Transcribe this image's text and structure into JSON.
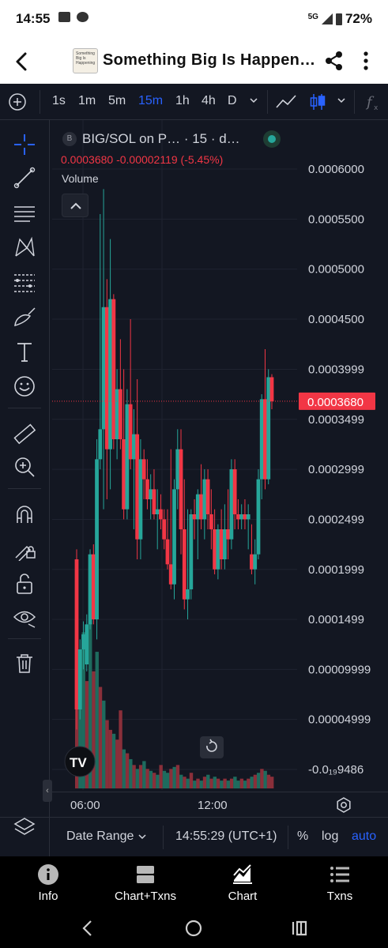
{
  "status_bar": {
    "time": "14:55",
    "network": "5G",
    "battery": "72%"
  },
  "app_bar": {
    "title": "Something Big Is Happeni…",
    "thumbnail_text": "Something Big Is Happening"
  },
  "toolbar": {
    "intervals": [
      "1s",
      "1m",
      "5m",
      "15m",
      "1h",
      "4h",
      "D"
    ],
    "active_interval": "15m"
  },
  "legend": {
    "chip": "B",
    "symbol": "BIG/SOL on P…",
    "interval_text": "· 15 · d…",
    "price_line": "0.0003680  -0.00002119 (-5.45%)",
    "volume_label": "Volume"
  },
  "colors": {
    "up": "#26a69a",
    "down": "#f23645",
    "vol_up": "#1e6b5e",
    "vol_down": "#8a2f3a",
    "background": "#131722",
    "accent": "#2962ff"
  },
  "chart_data": {
    "type": "candlestick",
    "pair": "BIG/SOL",
    "interval": "15",
    "y_ticks": [
      "0.0006000",
      "0.0005500",
      "0.0005000",
      "0.0004500",
      "0.0003999",
      "0.0003499",
      "0.0002999",
      "0.0002499",
      "0.0001999",
      "0.0001499",
      "0.00009999",
      "0.00004999",
      "-0.0₁₉9486"
    ],
    "y_tick_values": [
      0.0006,
      0.00055,
      0.0005,
      0.00045,
      0.0003999,
      0.0003499,
      0.0002999,
      0.0002499,
      0.0001999,
      0.0001499,
      9.999e-05,
      4.999e-05,
      0
    ],
    "ylim": [
      0,
      0.0006
    ],
    "x_ticks": [
      "06:00",
      "12:00"
    ],
    "last_price": "0.0003680",
    "last_price_value": 0.000368,
    "grid": true,
    "candles": [
      {
        "o": 0.00021,
        "h": 0.00022,
        "l": 4e-05,
        "c": 6e-05
      },
      {
        "o": 6e-05,
        "h": 0.00013,
        "l": 5e-05,
        "c": 0.00012
      },
      {
        "o": 0.00012,
        "h": 0.000148,
        "l": 0.0001,
        "c": 0.000135
      },
      {
        "o": 0.000105,
        "h": 0.000155,
        "l": 9.8e-05,
        "c": 0.000145
      },
      {
        "o": 0.000145,
        "h": 0.00022,
        "l": 0.00014,
        "c": 0.000215
      },
      {
        "o": 0.000215,
        "h": 0.000225,
        "l": 0.000145,
        "c": 0.00015
      },
      {
        "o": 0.00015,
        "h": 0.00033,
        "l": 0.00013,
        "c": 0.00031
      },
      {
        "o": 0.00031,
        "h": 0.000555,
        "l": 0.0003,
        "c": 0.00034
      },
      {
        "o": 0.00034,
        "h": 0.00058,
        "l": 0.00026,
        "c": 0.000462
      },
      {
        "o": 0.000462,
        "h": 0.00049,
        "l": 0.00027,
        "c": 0.00032
      },
      {
        "o": 0.00032,
        "h": 0.00053,
        "l": 0.00028,
        "c": 0.00047
      },
      {
        "o": 0.00047,
        "h": 0.000475,
        "l": 0.00032,
        "c": 0.00033
      },
      {
        "o": 0.00033,
        "h": 0.0004,
        "l": 0.00031,
        "c": 0.00038
      },
      {
        "o": 0.00038,
        "h": 0.00043,
        "l": 0.00032,
        "c": 0.00033
      },
      {
        "o": 0.00033,
        "h": 0.0004,
        "l": 0.00025,
        "c": 0.00026
      },
      {
        "o": 0.00026,
        "h": 0.00038,
        "l": 0.00025,
        "c": 0.000365
      },
      {
        "o": 0.000365,
        "h": 0.00045,
        "l": 0.0003,
        "c": 0.00031
      },
      {
        "o": 0.00031,
        "h": 0.00036,
        "l": 0.00024,
        "c": 0.000335
      },
      {
        "o": 0.000335,
        "h": 0.00039,
        "l": 0.00021,
        "c": 0.00023
      },
      {
        "o": 0.00023,
        "h": 0.00033,
        "l": 0.00021,
        "c": 0.00031
      },
      {
        "o": 0.00031,
        "h": 0.00032,
        "l": 0.00027,
        "c": 0.00029
      },
      {
        "o": 0.00029,
        "h": 0.00031,
        "l": 0.00026,
        "c": 0.00027
      },
      {
        "o": 0.00027,
        "h": 0.000295,
        "l": 0.00025,
        "c": 0.00028
      },
      {
        "o": 0.00028,
        "h": 0.0003,
        "l": 0.00025,
        "c": 0.000255
      },
      {
        "o": 0.000255,
        "h": 0.00028,
        "l": 0.00022,
        "c": 0.00026
      },
      {
        "o": 0.00026,
        "h": 0.000275,
        "l": 0.00024,
        "c": 0.00025
      },
      {
        "o": 0.00025,
        "h": 0.00026,
        "l": 0.00022,
        "c": 0.00023
      },
      {
        "o": 0.00023,
        "h": 0.00026,
        "l": 0.0002,
        "c": 0.000205
      },
      {
        "o": 0.000205,
        "h": 0.00032,
        "l": 0.00018,
        "c": 0.000185
      },
      {
        "o": 0.000185,
        "h": 0.00029,
        "l": 0.00017,
        "c": 0.00028
      },
      {
        "o": 0.00028,
        "h": 0.00034,
        "l": 0.00026,
        "c": 0.00032
      },
      {
        "o": 0.00032,
        "h": 0.00034,
        "l": 0.000215,
        "c": 0.00024
      },
      {
        "o": 0.00024,
        "h": 0.00029,
        "l": 0.00016,
        "c": 0.00017
      },
      {
        "o": 0.00017,
        "h": 0.00026,
        "l": 0.00015,
        "c": 0.00018
      },
      {
        "o": 0.00018,
        "h": 0.00026,
        "l": 0.00017,
        "c": 0.000255
      },
      {
        "o": 0.000255,
        "h": 0.00027,
        "l": 0.00023,
        "c": 0.00025
      },
      {
        "o": 0.00025,
        "h": 0.00028,
        "l": 0.00021,
        "c": 0.000275
      },
      {
        "o": 0.000275,
        "h": 0.000305,
        "l": 0.00024,
        "c": 0.00025
      },
      {
        "o": 0.00025,
        "h": 0.0003,
        "l": 0.00023,
        "c": 0.00029
      },
      {
        "o": 0.00029,
        "h": 0.0003,
        "l": 0.00024,
        "c": 0.000255
      },
      {
        "o": 0.000255,
        "h": 0.00028,
        "l": 0.00022,
        "c": 0.00024
      },
      {
        "o": 0.00024,
        "h": 0.00026,
        "l": 0.000195,
        "c": 0.0002
      },
      {
        "o": 0.0002,
        "h": 0.000245,
        "l": 0.00019,
        "c": 0.00024
      },
      {
        "o": 0.00024,
        "h": 0.00026,
        "l": 0.0002,
        "c": 0.00021
      },
      {
        "o": 0.00021,
        "h": 0.000265,
        "l": 0.0002,
        "c": 0.00024
      },
      {
        "o": 0.00024,
        "h": 0.00028,
        "l": 0.00021,
        "c": 0.00023
      },
      {
        "o": 0.00023,
        "h": 0.00031,
        "l": 0.00022,
        "c": 0.0003
      },
      {
        "o": 0.0003,
        "h": 0.00031,
        "l": 0.00024,
        "c": 0.000255
      },
      {
        "o": 0.000255,
        "h": 0.00027,
        "l": 0.00024,
        "c": 0.00025
      },
      {
        "o": 0.00025,
        "h": 0.000265,
        "l": 0.00024,
        "c": 0.000255
      },
      {
        "o": 0.000255,
        "h": 0.00027,
        "l": 0.00024,
        "c": 0.00025
      },
      {
        "o": 0.00025,
        "h": 0.000265,
        "l": 0.00022,
        "c": 0.000255
      },
      {
        "o": 0.000215,
        "h": 0.000245,
        "l": 0.000195,
        "c": 0.0002
      },
      {
        "o": 0.0002,
        "h": 0.00023,
        "l": 0.000185,
        "c": 0.000215
      },
      {
        "o": 0.000215,
        "h": 0.0003,
        "l": 0.00021,
        "c": 0.00029
      },
      {
        "o": 0.00029,
        "h": 0.000375,
        "l": 0.00027,
        "c": 0.00037
      },
      {
        "o": 0.00037,
        "h": 0.00042,
        "l": 0.00028,
        "c": 0.00029
      },
      {
        "o": 0.00029,
        "h": 0.0004,
        "l": 0.000285,
        "c": 0.000392
      },
      {
        "o": 0.000392,
        "h": 0.000395,
        "l": 0.00036,
        "c": 0.000368
      }
    ],
    "volume": [
      {
        "v": 65,
        "up": false
      },
      {
        "v": 70,
        "up": true
      },
      {
        "v": 80,
        "up": true
      },
      {
        "v": 55,
        "up": false
      },
      {
        "v": 85,
        "up": true
      },
      {
        "v": 60,
        "up": false
      },
      {
        "v": 70,
        "up": true
      },
      {
        "v": 52,
        "up": false
      },
      {
        "v": 45,
        "up": true
      },
      {
        "v": 35,
        "up": false
      },
      {
        "v": 30,
        "up": false
      },
      {
        "v": 28,
        "up": true
      },
      {
        "v": 25,
        "up": false
      },
      {
        "v": 40,
        "up": false
      },
      {
        "v": 20,
        "up": true
      },
      {
        "v": 18,
        "up": false
      },
      {
        "v": 15,
        "up": true
      },
      {
        "v": 12,
        "up": false
      },
      {
        "v": 10,
        "up": true
      },
      {
        "v": 12,
        "up": false
      },
      {
        "v": 14,
        "up": true
      },
      {
        "v": 10,
        "up": false
      },
      {
        "v": 9,
        "up": true
      },
      {
        "v": 8,
        "up": false
      },
      {
        "v": 7,
        "up": true
      },
      {
        "v": 12,
        "up": false
      },
      {
        "v": 9,
        "up": true
      },
      {
        "v": 8,
        "up": true
      },
      {
        "v": 10,
        "up": false
      },
      {
        "v": 11,
        "up": true
      },
      {
        "v": 12,
        "up": false
      },
      {
        "v": 7,
        "up": true
      },
      {
        "v": 6,
        "up": false
      },
      {
        "v": 5,
        "up": true
      },
      {
        "v": 8,
        "up": false
      },
      {
        "v": 4,
        "up": true
      },
      {
        "v": 5,
        "up": false
      },
      {
        "v": 4,
        "up": true
      },
      {
        "v": 6,
        "up": false
      },
      {
        "v": 7,
        "up": true
      },
      {
        "v": 5,
        "up": false
      },
      {
        "v": 6,
        "up": true
      },
      {
        "v": 5,
        "up": false
      },
      {
        "v": 4,
        "up": true
      },
      {
        "v": 5,
        "up": false
      },
      {
        "v": 4,
        "up": true
      },
      {
        "v": 5,
        "up": false
      },
      {
        "v": 6,
        "up": true
      },
      {
        "v": 4,
        "up": true
      },
      {
        "v": 5,
        "up": false
      },
      {
        "v": 4,
        "up": true
      },
      {
        "v": 5,
        "up": false
      },
      {
        "v": 6,
        "up": true
      },
      {
        "v": 7,
        "up": false
      },
      {
        "v": 8,
        "up": true
      },
      {
        "v": 10,
        "up": false
      },
      {
        "v": 9,
        "up": true
      },
      {
        "v": 7,
        "up": false
      },
      {
        "v": 6,
        "up": false
      }
    ]
  },
  "bottom_bar": {
    "date_range": "Date Range",
    "clock": "14:55:29 (UTC+1)",
    "percent": "%",
    "log": "log",
    "auto": "auto"
  },
  "tabs": [
    {
      "label": "Info",
      "icon": "info-icon"
    },
    {
      "label": "Chart+Txns",
      "icon": "split-view-icon"
    },
    {
      "label": "Chart",
      "icon": "chart-icon"
    },
    {
      "label": "Txns",
      "icon": "list-icon"
    }
  ]
}
